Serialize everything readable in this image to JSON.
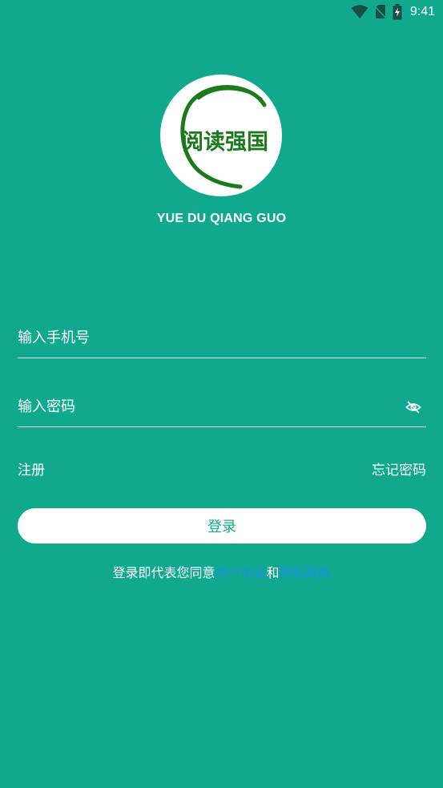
{
  "status_bar": {
    "time": "9:41",
    "icons": [
      "wifi-icon",
      "no-sim-icon",
      "battery-charging-icon"
    ]
  },
  "logo": {
    "text": "阅读强国",
    "caption": "YUE DU QIANG GUO",
    "colors": {
      "ring": "#1b7a1b",
      "text": "#1b7a1b",
      "background": "#ffffff"
    }
  },
  "form": {
    "phone_placeholder": "输入手机号",
    "password_placeholder": "输入密码",
    "password_toggle_icon": "eye-off-icon"
  },
  "links": {
    "register": "注册",
    "forgot_password": "忘记密码"
  },
  "login_button": "登录",
  "agreement": {
    "prefix": "登录即代表您同意",
    "user_agreement": "用户协议",
    "and": "和",
    "privacy_policy": "隐私政策"
  },
  "colors": {
    "background": "#10a98e",
    "button_bg": "#ffffff",
    "button_text": "#10a98e",
    "link": "#1b8fe8"
  }
}
